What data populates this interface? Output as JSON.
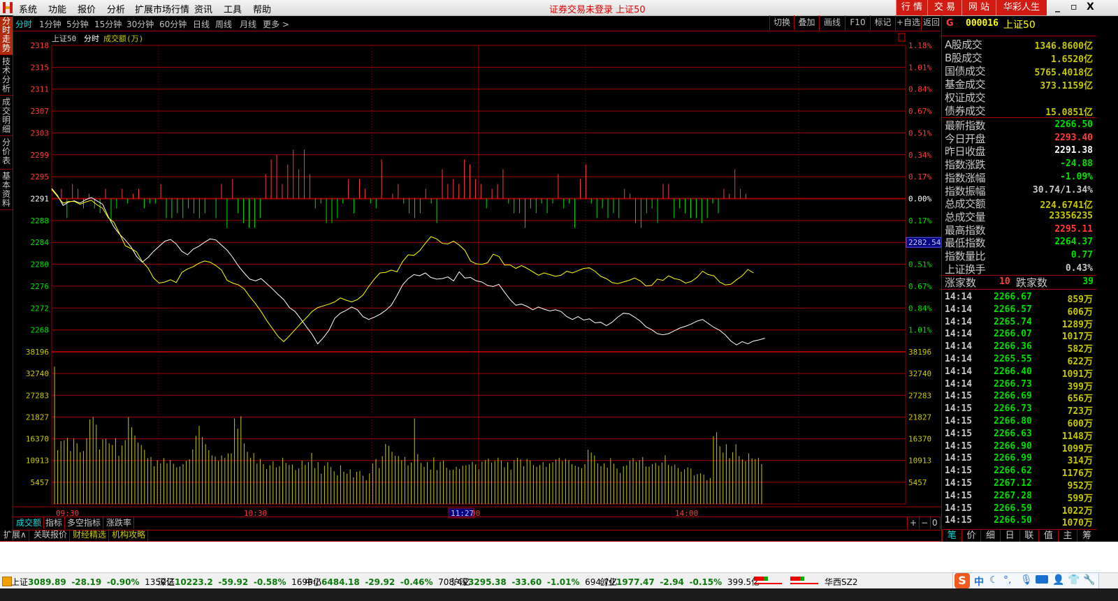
{
  "titlebar": {
    "menu": [
      "系统",
      "功能",
      "报价",
      "分析",
      "扩展市场行情",
      "资讯",
      "工具",
      "帮助"
    ],
    "center_title": "证券交易未登录   上证50",
    "buttons": [
      "行 情",
      "交 易",
      "网 站",
      "华彩人生"
    ],
    "window_controls": {
      "minimize": "_",
      "restore": "▫",
      "close": "X"
    }
  },
  "left_tabs": [
    {
      "label": "分时走势",
      "active": true
    },
    {
      "label": "技术分析",
      "active": false
    },
    {
      "label": "成交明细",
      "active": false
    },
    {
      "label": "分价表",
      "active": false
    },
    {
      "label": "基本资料",
      "active": false
    }
  ],
  "period_tabs": [
    {
      "label": "分时",
      "active": true
    },
    {
      "label": "1分钟"
    },
    {
      "label": "5分钟"
    },
    {
      "label": "15分钟"
    },
    {
      "label": "30分钟"
    },
    {
      "label": "60分钟"
    },
    {
      "label": "日线"
    },
    {
      "label": "周线"
    },
    {
      "label": "月线"
    },
    {
      "label": "更多 >"
    }
  ],
  "toolbar": [
    "切换",
    "叠加",
    "画线",
    "F10",
    "标记",
    "+自选",
    "返回"
  ],
  "chart_header": {
    "name": "上证50",
    "mode": "分时",
    "indicator": "成交额(万)"
  },
  "colors": {
    "up": "#ff3c3c",
    "down": "#00e000",
    "flat": "#ffffff",
    "volume": "#c8c800",
    "grid": "#a00000",
    "index_line": "#ffffff",
    "avg_line": "#ffff00",
    "cursor_bg": "#000080"
  },
  "chart_data": {
    "type": "line",
    "title": "上证50 分时",
    "prev_close": 2291.38,
    "price_axis": {
      "ticks": [
        2318,
        2315,
        2311,
        2307,
        2303,
        2299,
        2295,
        2291,
        2288,
        2284,
        2280,
        2276,
        2272,
        2268
      ],
      "pct_ticks": [
        "1.18%",
        "1.01%",
        "0.84%",
        "0.67%",
        "0.51%",
        "0.34%",
        "0.17%",
        "0.00%",
        "0.17%",
        "0.34%",
        "0.51%",
        "0.67%",
        "0.84%",
        "1.01%"
      ],
      "range": [
        2264.4,
        2318.4
      ]
    },
    "cursor_price_label": "2282.54",
    "cursor_time_label": "11:27",
    "volume_axis": {
      "ticks": [
        38196,
        32740,
        27283,
        21827,
        16370,
        10913,
        5457
      ],
      "range": [
        0,
        38196
      ]
    },
    "x_ticks": [
      "09:30",
      "10:30",
      "11:27",
      "00",
      "14:00"
    ],
    "series": [
      {
        "name": "指数",
        "color": "white",
        "values": [
          2293.2,
          2292.0,
          2290.2,
          2290.8,
          2291.0,
          2290.6,
          2291.2,
          2291.6,
          2291.0,
          2290.4,
          2288.2,
          2286.4,
          2285.1,
          2284.1,
          2282.9,
          2281.2,
          2280.2,
          2281.0,
          2282.1,
          2283.0,
          2283.9,
          2284.2,
          2283.4,
          2282.1,
          2281.5,
          2282.5,
          2283.0,
          2283.7,
          2284.3,
          2284.1,
          2283.2,
          2282.3,
          2281.0,
          2279.5,
          2278.3,
          2277.2,
          2276.9,
          2277.3,
          2276.4,
          2275.5,
          2274.5,
          2273.6,
          2272.2,
          2271.5,
          2270.2,
          2268.8,
          2267.5,
          2265.8,
          2266.9,
          2268.2,
          2270.3,
          2271.2,
          2271.7,
          2272.3,
          2271.8,
          2270.6,
          2270.1,
          2270.5,
          2271.0,
          2271.7,
          2272.6,
          2274.3,
          2276.2,
          2277.3,
          2278.0,
          2277.8,
          2278.3,
          2277.5,
          2277.2,
          2277.3,
          2277.6,
          2276.9,
          2278.5,
          2277.4,
          2277.5,
          2276.9,
          2276.7,
          2276.1,
          2275.9,
          2276.3,
          2274.9,
          2273.6,
          2272.6,
          2272.8,
          2272.4,
          2271.8,
          2272.3,
          2271.9,
          2271.6,
          2271.8,
          2271.5,
          2270.6,
          2270.1,
          2270.6,
          2270.0,
          2270.2,
          2269.5,
          2269.6,
          2269.0,
          2269.6,
          2270.5,
          2271.2,
          2271.1,
          2270.5,
          2269.8,
          2268.8,
          2268.3,
          2267.6,
          2267.4,
          2267.6,
          2268.1,
          2268.6,
          2268.9,
          2269.3,
          2269.8,
          2270.1,
          2269.4,
          2268.7,
          2268.2,
          2267.4,
          2266.3,
          2265.6,
          2266.2,
          2265.8,
          2266.3,
          2266.5,
          2266.8
        ]
      },
      {
        "name": "均价",
        "color": "yellow",
        "values": [
          2293.0,
          2291.8,
          2290.6,
          2290.9,
          2290.9,
          2290.4,
          2290.8,
          2291.1,
          2290.3,
          2289.7,
          2288.0,
          2287.2,
          2285.2,
          2283.1,
          2282.6,
          2282.0,
          2280.3,
          2279.2,
          2277.4,
          2276.5,
          2276.7,
          2277.1,
          2276.6,
          2278.4,
          2279.0,
          2279.4,
          2280.0,
          2280.4,
          2280.2,
          2279.6,
          2278.8,
          2277.0,
          2276.5,
          2276.2,
          2275.5,
          2274.1,
          2272.9,
          2271.5,
          2269.9,
          2268.5,
          2267.1,
          2266.2,
          2267.2,
          2268.3,
          2269.4,
          2270.4,
          2271.5,
          2272.2,
          2272.5,
          2272.8,
          2273.2,
          2273.9,
          2273.5,
          2273.2,
          2273.6,
          2274.4,
          2275.9,
          2277.2,
          2278.3,
          2278.4,
          2278.8,
          2278.5,
          2280.3,
          2281.5,
          2281.4,
          2282.2,
          2283.5,
          2284.7,
          2284.3,
          2283.5,
          2283.4,
          2283.9,
          2283.2,
          2282.3,
          2280.4,
          2279.9,
          2279.8,
          2280.1,
          2281.6,
          2281.2,
          2279.7,
          2279.7,
          2279.1,
          2279.6,
          2279.1,
          2278.5,
          2277.9,
          2278.3,
          2278.0,
          2277.7,
          2277.9,
          2278.6,
          2278.3,
          2278.7,
          2279.1,
          2279.2,
          2278.6,
          2277.7,
          2277.3,
          2276.6,
          2276.4,
          2276.7,
          2277.0,
          2277.4,
          2276.9,
          2276.0,
          2276.1,
          2277.2,
          2277.0,
          2277.8,
          2277.3,
          2277.1,
          2276.5,
          2276.8,
          2277.5,
          2278.6,
          2278.0,
          2277.8,
          2276.7,
          2276.2,
          2276.3,
          2277.1,
          2277.8,
          2278.9,
          2278.3
        ]
      }
    ],
    "flow_bars": [
      0,
      2,
      -4,
      3,
      2,
      -2,
      1,
      -2,
      -3,
      2,
      -5,
      -2,
      2,
      -1,
      1,
      2,
      -2,
      -1,
      -1,
      3,
      -4,
      -4,
      -3,
      -4,
      -2,
      -3,
      -4,
      -3,
      0,
      -4,
      3,
      -6,
      4,
      -3,
      -5,
      -6,
      -6,
      -4,
      5,
      8,
      9,
      3,
      7,
      10,
      6,
      10,
      5,
      -2,
      -1,
      -5,
      -5,
      -4,
      -1,
      4,
      -3,
      4,
      2,
      -1,
      -2,
      8,
      0,
      1,
      3,
      -1,
      -3,
      -4,
      -3,
      2,
      -1,
      -5,
      6,
      3,
      4,
      3,
      8,
      7,
      4,
      3,
      -2,
      2,
      3,
      6,
      -1,
      -3,
      -3,
      -6,
      -2,
      -3,
      -1,
      -3,
      -1,
      5,
      -2,
      -1,
      -6,
      4,
      7,
      -1,
      -4,
      -2,
      -4,
      -3,
      -4,
      2,
      1,
      -5,
      -6,
      -3,
      -2,
      -5,
      3,
      3,
      -4,
      -2,
      -3,
      -4,
      -4,
      -5,
      -4,
      -1,
      -3,
      2,
      1,
      6,
      2,
      1
    ]
  },
  "volume_bars": [
    34500,
    13500,
    15800,
    16000,
    16600,
    13300,
    16400,
    15200,
    13000,
    13300,
    16500,
    21200,
    21800,
    19900,
    13700,
    16200,
    16400,
    15200,
    14800,
    16500,
    12100,
    14700,
    16000,
    21800,
    19300,
    17200,
    15400,
    14800,
    13600,
    11500,
    11800,
    9500,
    11000,
    10200,
    11500,
    10200,
    11000,
    10100,
    9200,
    9400,
    10000,
    10800,
    11200,
    13700,
    17100,
    19600,
    16800,
    15000,
    13500,
    12200,
    11900,
    10800,
    12200,
    11600,
    12700,
    12700,
    21500,
    18900,
    22000,
    15200,
    13100,
    11600,
    12800,
    10100,
    11300,
    10000,
    8800,
    9700,
    10700,
    9200,
    9500,
    11600,
    10300,
    9800,
    9900,
    8500,
    8900,
    10900,
    9800,
    10500,
    12800,
    9000,
    10500,
    7600,
    9600,
    10500,
    9300,
    8200,
    7200,
    9700,
    8100,
    7600,
    8700,
    6700,
    8100,
    8300,
    7100,
    6000,
    7700,
    10200,
    11300,
    9000,
    12000,
    15100,
    14600,
    13100,
    12100,
    12000,
    11000,
    11800,
    9700,
    10400,
    21500,
    12500,
    10300,
    9300,
    10500,
    8600,
    11700,
    8500,
    10600,
    10900,
    9100,
    8500,
    8600,
    9300,
    8800,
    9600,
    9700,
    9900,
    10600,
    9900,
    8700,
    10600,
    11000,
    11400,
    10400,
    10800,
    11600,
    10900,
    9200,
    10500,
    8600,
    11000,
    11600,
    11200,
    9500,
    11300,
    10900,
    9800,
    9300,
    9800,
    10500,
    9300,
    10200,
    10500,
    11200,
    11600,
    10800,
    11300,
    11000,
    10000,
    9600,
    9300,
    9000,
    10000,
    13600,
    12900,
    12200,
    10200,
    9500,
    10200,
    9100,
    11500,
    10100,
    8900,
    7800,
    9500,
    9700,
    10900,
    11500,
    10600,
    11000,
    11800,
    9400,
    9400,
    10000,
    10300,
    9600,
    10400,
    12200,
    9800,
    9500,
    9900,
    9000,
    8100,
    8700,
    9200,
    8900,
    7200,
    7500,
    7700,
    7400,
    6000,
    6500,
    17000,
    18000,
    14500,
    12900,
    15000,
    11500,
    13000,
    15000,
    12000,
    11200,
    10700,
    12700,
    11400,
    11300,
    11600,
    10000,
    9900,
    11800,
    9500
  ],
  "bottom_tabs": {
    "indicator": [
      {
        "label": "成交额",
        "active": true
      },
      {
        "label": "指标"
      },
      {
        "label": "多空指标"
      },
      {
        "label": "涨跌率"
      }
    ],
    "zoom": [
      "+",
      "−",
      "0"
    ],
    "extend": [
      {
        "label": "扩展∧"
      },
      {
        "label": "关联报价"
      },
      {
        "label": "财经精选",
        "highlight": true
      },
      {
        "label": "机构攻略",
        "highlight": true
      }
    ]
  },
  "right_panel": {
    "header": {
      "icon": "G",
      "code": "000016",
      "name": "上证50"
    },
    "turnover": [
      {
        "label": "A股成交",
        "value": "1346.8600亿"
      },
      {
        "label": "B股成交",
        "value": "1.6520亿"
      },
      {
        "label": "国债成交",
        "value": "5765.4018亿"
      },
      {
        "label": "基金成交",
        "value": "373.1159亿"
      },
      {
        "label": "权证成交",
        "value": ""
      },
      {
        "label": "债券成交",
        "value": "15.0851亿"
      }
    ],
    "stats": [
      {
        "label": "最新指数",
        "value": "2266.50",
        "tone": "down"
      },
      {
        "label": "今日开盘",
        "value": "2293.40",
        "tone": "up"
      },
      {
        "label": "昨日收盘",
        "value": "2291.38",
        "tone": "flat"
      },
      {
        "label": "指数涨跌",
        "value": "-24.88",
        "tone": "down"
      },
      {
        "label": "指数涨幅",
        "value": "-1.09%",
        "tone": "down"
      },
      {
        "label": "指数振幅",
        "value": "30.74/1.34%",
        "tone": "neutral"
      },
      {
        "label": "总成交额",
        "value": "224.6741亿",
        "tone": "vol"
      },
      {
        "label": "总成交量",
        "value": "23356235",
        "tone": "vol"
      },
      {
        "label": "最高指数",
        "value": "2295.11",
        "tone": "up"
      },
      {
        "label": "最低指数",
        "value": "2264.37",
        "tone": "down"
      },
      {
        "label": "指数量比",
        "value": "0.77",
        "tone": "down"
      },
      {
        "label": "上证换手",
        "value": "0.43%",
        "tone": "neutral"
      }
    ],
    "breadth": {
      "up_label": "涨家数",
      "up_count": "10",
      "down_label": "跌家数",
      "down_count": "39"
    },
    "ticks": [
      {
        "time": "14:14",
        "price": "2266.67",
        "vol": "859万"
      },
      {
        "time": "14:14",
        "price": "2266.57",
        "vol": "606万"
      },
      {
        "time": "14:14",
        "price": "2265.74",
        "vol": "1289万"
      },
      {
        "time": "14:14",
        "price": "2266.07",
        "vol": "1017万"
      },
      {
        "time": "14:14",
        "price": "2266.36",
        "vol": "582万"
      },
      {
        "time": "14:14",
        "price": "2265.55",
        "vol": "622万"
      },
      {
        "time": "14:14",
        "price": "2266.40",
        "vol": "1091万"
      },
      {
        "time": "14:14",
        "price": "2266.73",
        "vol": "399万"
      },
      {
        "time": "14:15",
        "price": "2266.69",
        "vol": "656万"
      },
      {
        "time": "14:15",
        "price": "2266.73",
        "vol": "723万"
      },
      {
        "time": "14:15",
        "price": "2266.80",
        "vol": "600万"
      },
      {
        "time": "14:15",
        "price": "2266.63",
        "vol": "1148万"
      },
      {
        "time": "14:15",
        "price": "2266.90",
        "vol": "1099万"
      },
      {
        "time": "14:15",
        "price": "2266.99",
        "vol": "314万"
      },
      {
        "time": "14:15",
        "price": "2266.62",
        "vol": "1176万"
      },
      {
        "time": "14:15",
        "price": "2267.12",
        "vol": "952万"
      },
      {
        "time": "14:15",
        "price": "2267.28",
        "vol": "599万"
      },
      {
        "time": "14:15",
        "price": "2266.59",
        "vol": "1022万"
      },
      {
        "time": "14:15",
        "price": "2266.50",
        "vol": "1070万"
      }
    ],
    "tabs": [
      {
        "label": "笔",
        "active": true
      },
      {
        "label": "价"
      },
      {
        "label": "细"
      },
      {
        "label": "日"
      },
      {
        "label": "联"
      },
      {
        "label": "值"
      },
      {
        "label": "主"
      },
      {
        "label": "筹"
      }
    ]
  },
  "statusbar": {
    "indices": [
      {
        "name": "上证",
        "price": "3089.89",
        "chg": "-28.19",
        "pct": "-0.90%",
        "amount": "1350亿"
      },
      {
        "name": "深证",
        "price": "10223.2",
        "chg": "-59.92",
        "pct": "-0.58%",
        "amount": "1696亿"
      },
      {
        "name": "中小",
        "price": "6484.18",
        "chg": "-29.92",
        "pct": "-0.46%",
        "amount": "708.4亿"
      },
      {
        "name": "沪深",
        "price": "3295.38",
        "chg": "-33.60",
        "pct": "-1.01%",
        "amount": "694.7亿"
      },
      {
        "name": "创业",
        "price": "1977.47",
        "chg": "-2.94",
        "pct": "-0.15%",
        "amount": "399.5亿"
      }
    ],
    "server": "华西SZ2"
  },
  "ime": {
    "mode": "中",
    "items": [
      "moon-icon",
      "punct-icon",
      "mic-icon",
      "keyboard-icon",
      "user-icon",
      "shirt-icon",
      "wrench-icon"
    ]
  }
}
